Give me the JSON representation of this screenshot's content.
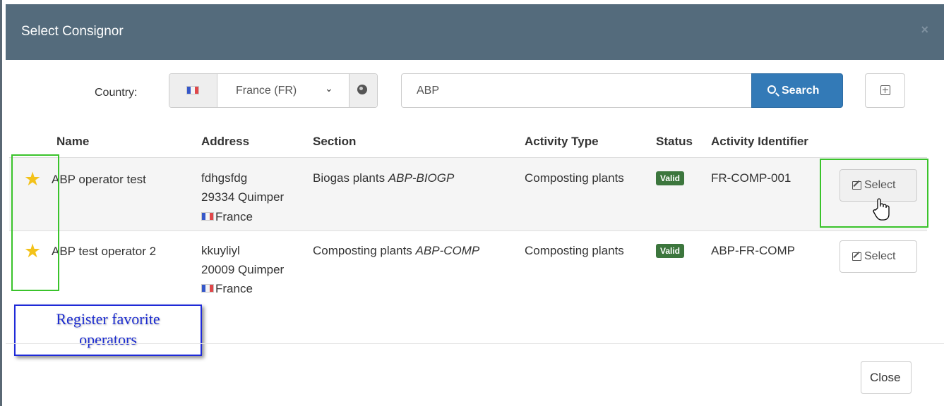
{
  "modal": {
    "title": "Select Consignor",
    "close_icon": "×"
  },
  "search": {
    "country_label": "Country:",
    "country_value": "France (FR)",
    "chevron": "⌄",
    "query": "ABP",
    "search_label": "Search"
  },
  "table": {
    "headers": [
      "Name",
      "Address",
      "Section",
      "Activity Type",
      "Status",
      "Activity Identifier"
    ],
    "rows": [
      {
        "favorite": "★",
        "name": "ABP operator test",
        "address_street": "fdhgsfdg",
        "address_city": "29334 Quimper",
        "address_country": "France",
        "section": "Biogas plants",
        "section_code": "ABP-BIOGP",
        "activity_type": "Composting plants",
        "status": "Valid",
        "activity_identifier": "FR-COMP-001",
        "select_label": "Select"
      },
      {
        "favorite": "★",
        "name": "ABP test operator 2",
        "address_street": "kkuyliyl",
        "address_city": "20009 Quimper",
        "address_country": "France",
        "section": "Composting plants",
        "section_code": "ABP-COMP",
        "activity_type": "Composting plants",
        "status": "Valid",
        "activity_identifier": "ABP-FR-COMP",
        "select_label": "Select"
      }
    ]
  },
  "annotation": {
    "line1": "Register favorite",
    "line2": "operators"
  },
  "footer": {
    "close_label": "Close"
  },
  "colors": {
    "header": "#546b7c",
    "primary": "#337ab7",
    "valid_badge": "#3c763d",
    "star": "#f3c21a",
    "highlight_green": "#3ac32b",
    "annotation_blue": "#1e2ad8"
  },
  "icons": [
    "close-icon",
    "france-flag-icon",
    "chevron-down-icon",
    "globe-icon",
    "search-icon",
    "expand-icon",
    "star-icon",
    "edit-icon",
    "hand-cursor-icon"
  ]
}
